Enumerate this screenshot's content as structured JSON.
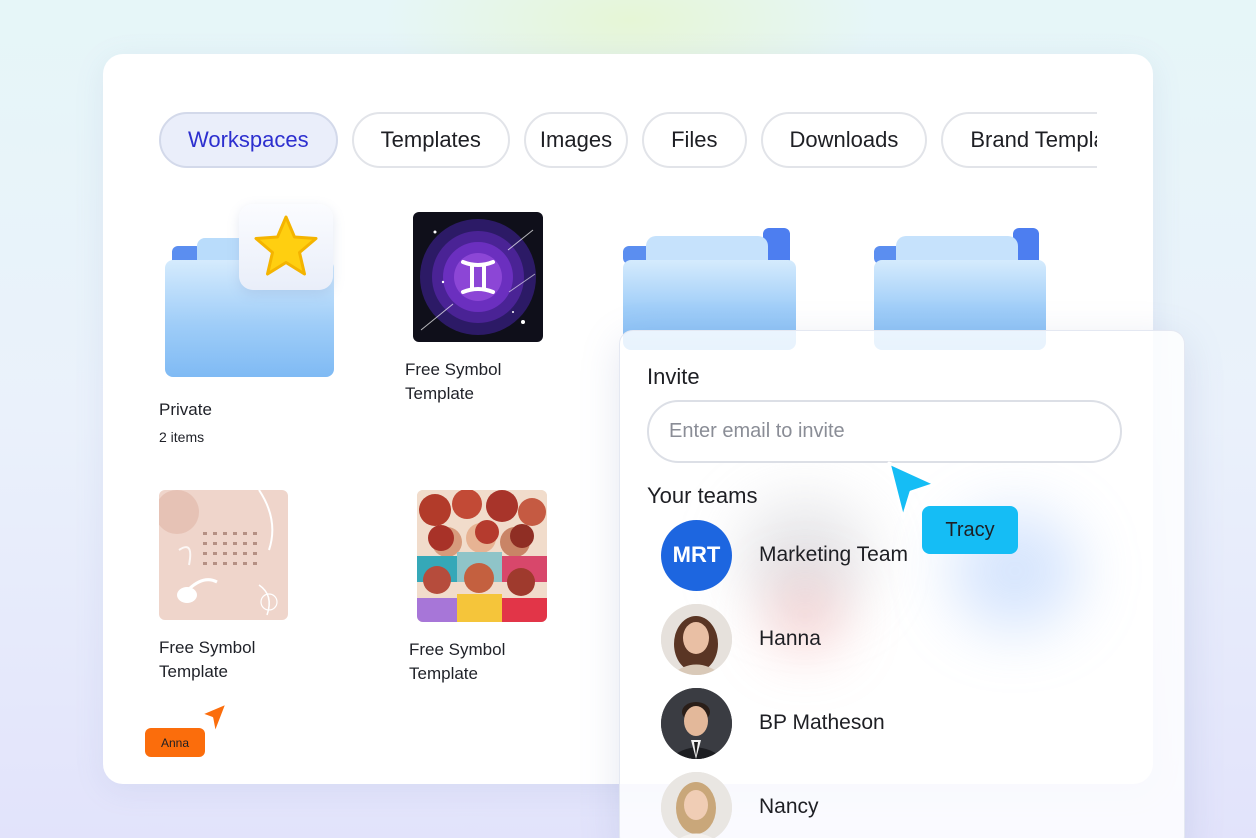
{
  "tabs": [
    {
      "label": "Workspaces",
      "active": true
    },
    {
      "label": "Templates",
      "active": false
    },
    {
      "label": "Images",
      "active": false
    },
    {
      "label": "Files",
      "active": false
    },
    {
      "label": "Downloads",
      "active": false
    },
    {
      "label": "Brand Templates",
      "active": false
    }
  ],
  "items": {
    "private": {
      "title": "Private",
      "subtitle": "2 items",
      "icon": "star-icon"
    },
    "template1": {
      "title": "Free Symbol Template",
      "icon": "gemini-icon"
    },
    "template2": {
      "title": "Free Symbol Template"
    },
    "template3": {
      "title": "Free Symbol Template"
    }
  },
  "invite": {
    "title": "Invite",
    "placeholder": "Enter email to invite",
    "teams_title": "Your teams",
    "members": [
      {
        "name": "Marketing Team",
        "initials": "MRT",
        "color": "#1d66e0"
      },
      {
        "name": "Hanna"
      },
      {
        "name": "BP Matheson"
      },
      {
        "name": "Nancy"
      }
    ]
  },
  "cursors": [
    {
      "label": "Tracy",
      "color": "#15bdf5"
    },
    {
      "label": "Anna",
      "color": "#fb6d0c"
    }
  ]
}
